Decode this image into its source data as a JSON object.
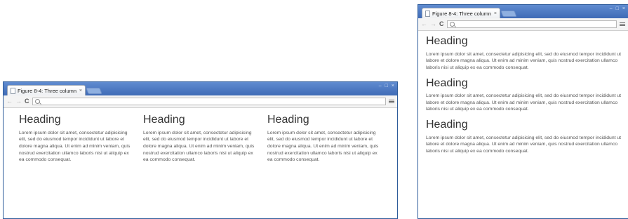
{
  "browsers": {
    "wide": {
      "tab_title": "Figure 8-4: Three column",
      "tab_close": "×",
      "window_controls": [
        "–",
        "□",
        "×"
      ],
      "nav": {
        "back": "←",
        "forward": "→",
        "reload": "C"
      },
      "columns": [
        {
          "heading": "Heading",
          "text": "Lorem ipsum dolor sit amet, consectetur adipisicing elit, sed do eiusmod tempor incididunt ut labore et dolore magna aliqua. Ut enim ad minim veniam, quis nostrud exercitation ullamco laboris nisi ut aliquip ex ea commodo consequat."
        },
        {
          "heading": "Heading",
          "text": "Lorem ipsum dolor sit amet, consectetur adipisicing elit, sed do eiusmod tempor incididunt ut labore et dolore magna aliqua. Ut enim ad minim veniam, quis nostrud exercitation ullamco laboris nisi ut aliquip ex ea commodo consequat."
        },
        {
          "heading": "Heading",
          "text": "Lorem ipsum dolor sit amet, consectetur adipisicing elit, sed do eiusmod tempor incididunt ut labore et dolore magna aliqua. Ut enim ad minim veniam, quis nostrud exercitation ullamco laboris nisi ut aliquip ex ea commodo consequat."
        }
      ]
    },
    "narrow": {
      "tab_title": "Figure 8-4: Three column",
      "tab_close": "×",
      "window_controls": [
        "–",
        "□",
        "×"
      ],
      "nav": {
        "back": "←",
        "forward": "→",
        "reload": "C"
      },
      "columns": [
        {
          "heading": "Heading",
          "text": "Lorem ipsum dolor sit amet, consectetur adipisicing elit, sed do eiusmod tempor incididunt ut labore et dolore magna aliqua. Ut enim ad minim veniam, quis nostrud exercitation ullamco laboris nisi ut aliquip ex ea commodo consequat."
        },
        {
          "heading": "Heading",
          "text": "Lorem ipsum dolor sit amet, consectetur adipisicing elit, sed do eiusmod tempor incididunt ut labore et dolore magna aliqua. Ut enim ad minim veniam, quis nostrud exercitation ullamco laboris nisi ut aliquip ex ea commodo consequat."
        },
        {
          "heading": "Heading",
          "text": "Lorem ipsum dolor sit amet, consectetur adipisicing elit, sed do eiusmod tempor incididunt ut labore et dolore magna aliqua. Ut enim ad minim veniam, quis nostrud exercitation ullamco laboris nisi ut aliquip ex ea commodo consequat."
        }
      ]
    }
  },
  "icons": {
    "page": "page-icon",
    "search": "search-icon",
    "menu": "menu-icon"
  },
  "colors": {
    "titlebar": "#4a76c0",
    "heading": "#333333",
    "text": "#555555"
  }
}
